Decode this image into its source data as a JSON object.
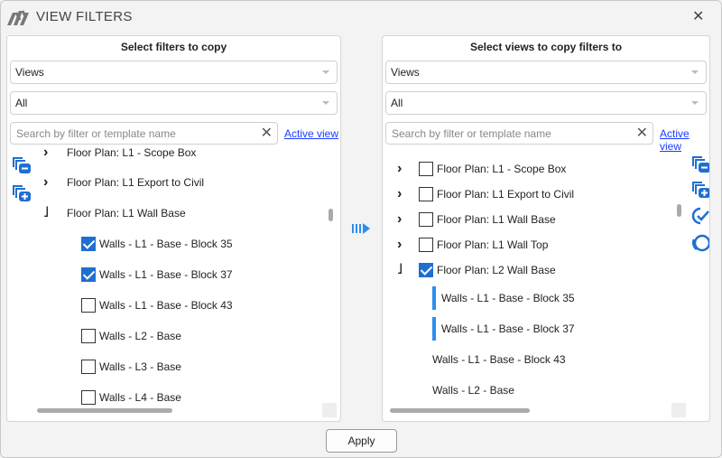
{
  "window": {
    "title": "VIEW FILTERS"
  },
  "left": {
    "heading": "Select filters to copy",
    "dropdown1": "Views",
    "dropdown2": "All",
    "search_placeholder": "Search by filter or template name",
    "active_view": "Active view",
    "items": [
      {
        "label": "Floor Plan: L1 - Scope Box",
        "type": "parent",
        "expander": "collapsed"
      },
      {
        "label": "Floor Plan: L1 Export to Civil",
        "type": "parent",
        "expander": "collapsed"
      },
      {
        "label": "Floor Plan: L1 Wall Base",
        "type": "parent",
        "expander": "expanded"
      },
      {
        "label": "Walls - L1 - Base - Block 35",
        "type": "child",
        "checked": true
      },
      {
        "label": "Walls - L1 - Base - Block 37",
        "type": "child",
        "checked": true
      },
      {
        "label": "Walls - L1 - Base - Block 43",
        "type": "child",
        "checked": false
      },
      {
        "label": "Walls - L2 - Base",
        "type": "child",
        "checked": false
      },
      {
        "label": "Walls - L3 - Base",
        "type": "child",
        "checked": false
      },
      {
        "label": "Walls - L4 - Base",
        "type": "child",
        "checked": false
      }
    ]
  },
  "right": {
    "heading": "Select views to copy filters to",
    "dropdown1": "Views",
    "dropdown2": "All",
    "search_placeholder": "Search by filter or template name",
    "active_view": "Active view",
    "items": [
      {
        "label": "Floor Plan: L1 - Scope Box",
        "type": "parent",
        "checked": false
      },
      {
        "label": "Floor Plan: L1 Export to Civil",
        "type": "parent",
        "checked": false
      },
      {
        "label": "Floor Plan: L1 Wall Base",
        "type": "parent",
        "checked": false
      },
      {
        "label": "Floor Plan: L1 Wall Top",
        "type": "parent",
        "checked": false
      },
      {
        "label": "Floor Plan: L2 Wall Base",
        "type": "parent",
        "checked": true,
        "expanded": true
      },
      {
        "label": "Walls - L1 - Base - Block 35",
        "type": "child",
        "marked": true
      },
      {
        "label": "Walls - L1 - Base - Block 37",
        "type": "child",
        "marked": true
      },
      {
        "label": "Walls - L1 - Base - Block 43",
        "type": "child",
        "marked": false
      },
      {
        "label": "Walls - L2 - Base",
        "type": "child",
        "marked": false
      }
    ]
  },
  "apply_label": "Apply",
  "colors": {
    "accent": "#1f6fd1",
    "marker": "#2b8ef0"
  }
}
